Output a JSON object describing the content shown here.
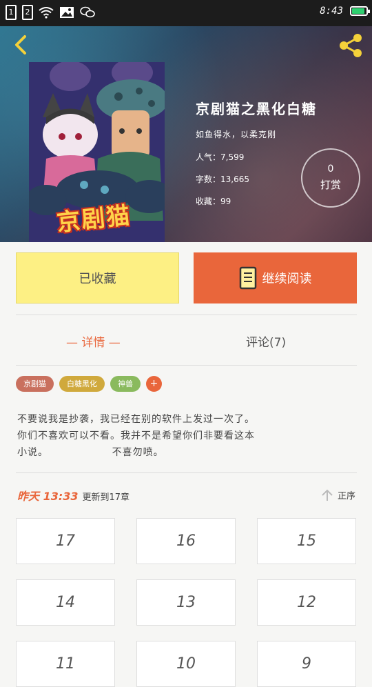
{
  "status_bar": {
    "sim1": "1",
    "sim2": "2",
    "time": "8:43",
    "battery_percent": 90,
    "battery_color": "#2fd070"
  },
  "icons": {
    "back": "chevron-left-icon",
    "share": "share-icon",
    "wifi": "wifi-icon",
    "image": "image-icon",
    "wechat": "wechat-icon",
    "continue_reading": "book-icon",
    "sort": "arrow-up-icon"
  },
  "book": {
    "title": "京剧猫之黑化白糖",
    "author": "如鱼得水，以柔克刚",
    "popularity": "人气：7,599",
    "word_count": "字数：13,665",
    "favorites": "收藏：99",
    "cover_text": "京剧猫"
  },
  "reward": {
    "count": "0",
    "label": "打赏"
  },
  "actions": {
    "favorited_label": "已收藏",
    "continue_label": "继续阅读"
  },
  "tabs": {
    "detail": "— 详情 —",
    "comments": "评论(7)"
  },
  "tags": [
    {
      "label": "京剧猫",
      "color": "#c9705e"
    },
    {
      "label": "白糖黑化",
      "color": "#d0a93c"
    },
    {
      "label": "神兽",
      "color": "#8aba5e"
    }
  ],
  "tag_add": "+",
  "description": {
    "line1": "不要说我是抄袭，我已经在别的软件上发过一次了。",
    "line2": "你们不喜欢可以不看。我并不是希望你们非要看这本",
    "line3": "小说。                 不喜勿喷。"
  },
  "update": {
    "time": "昨天 13:33",
    "text": "更新到17章",
    "sort_label": "正序"
  },
  "chapters": [
    "17",
    "16",
    "15",
    "14",
    "13",
    "12",
    "11",
    "10",
    "9"
  ],
  "colors": {
    "accent": "#e9663b",
    "favorite_bg": "#fdf084"
  }
}
